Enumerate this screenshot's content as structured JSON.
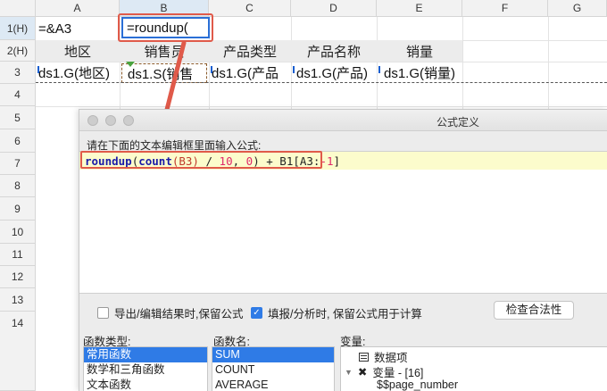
{
  "sheet": {
    "columns": [
      "A",
      "B",
      "C",
      "D",
      "E",
      "F",
      "G"
    ],
    "rows": [
      "1(H)",
      "2(H)",
      "3",
      "4",
      "5",
      "6",
      "7",
      "8",
      "9",
      "10",
      "11",
      "12",
      "13",
      "14"
    ],
    "a1_formula": "=&A3",
    "b1_editing": "=roundup(",
    "headers": [
      "地区",
      "销售员",
      "产品类型",
      "产品名称",
      "销量"
    ],
    "data_row": [
      "ds1.G(地区)",
      "ds1.S(销售",
      "ds1.G(产品",
      "ds1.G(产品)",
      "ds1.G(销量)"
    ]
  },
  "dialog": {
    "title": "公式定义",
    "instruction": "请在下面的文本编辑框里面输入公式:",
    "formula": {
      "fn1": "roundup",
      "open": "(",
      "fn2": "count",
      "arg": "(B3)",
      "rest1": " / ",
      "ten": "10",
      "comma": ", ",
      "zero": "0",
      "rest2": ") + B1[A3:",
      "neg1": "-1",
      "close": "]"
    },
    "checkbox1": {
      "label": "导出/编辑结果时,保留公式",
      "checked": false
    },
    "checkbox2": {
      "label": "填报/分析时, 保留公式用于计算",
      "checked": true
    },
    "check_button": "检查合法性",
    "func_types_label": "函数类型:",
    "func_types": [
      "常用函数",
      "数学和三角函数",
      "文本函数"
    ],
    "func_names_label": "函数名:",
    "func_names": [
      "SUM",
      "COUNT",
      "AVERAGE"
    ],
    "vars_label": "变量:",
    "vars_tree": {
      "item1": "数据项",
      "item2": "变量 - [16]",
      "item3": "$$page_number"
    }
  },
  "colors": {
    "callout": "#e05a4a",
    "selection_blue": "#2f7be6",
    "editor_highlight": "#fcfccc"
  }
}
